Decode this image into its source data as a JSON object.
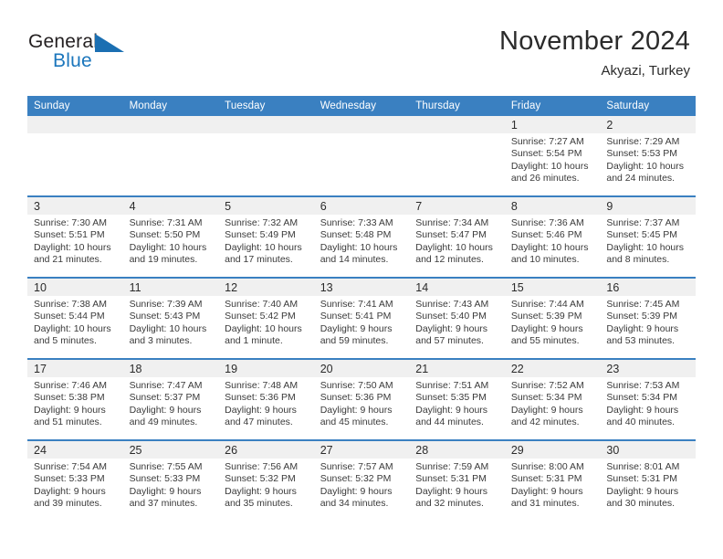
{
  "brand": {
    "name_part1": "General",
    "name_part2": "Blue",
    "mark": "triangle-logo"
  },
  "header": {
    "month_title": "November 2024",
    "location": "Akyazi, Turkey",
    "accent_color": "#3a80c1",
    "brand_blue": "#1b76bc"
  },
  "weekday_headers": [
    "Sunday",
    "Monday",
    "Tuesday",
    "Wednesday",
    "Thursday",
    "Friday",
    "Saturday"
  ],
  "weeks": [
    [
      {
        "day": "",
        "sunrise": "",
        "sunset": "",
        "daylight": "",
        "empty": true
      },
      {
        "day": "",
        "sunrise": "",
        "sunset": "",
        "daylight": "",
        "empty": true
      },
      {
        "day": "",
        "sunrise": "",
        "sunset": "",
        "daylight": "",
        "empty": true
      },
      {
        "day": "",
        "sunrise": "",
        "sunset": "",
        "daylight": "",
        "empty": true
      },
      {
        "day": "",
        "sunrise": "",
        "sunset": "",
        "daylight": "",
        "empty": true
      },
      {
        "day": "1",
        "sunrise": "Sunrise: 7:27 AM",
        "sunset": "Sunset: 5:54 PM",
        "daylight": "Daylight: 10 hours and 26 minutes.",
        "empty": false
      },
      {
        "day": "2",
        "sunrise": "Sunrise: 7:29 AM",
        "sunset": "Sunset: 5:53 PM",
        "daylight": "Daylight: 10 hours and 24 minutes.",
        "empty": false
      }
    ],
    [
      {
        "day": "3",
        "sunrise": "Sunrise: 7:30 AM",
        "sunset": "Sunset: 5:51 PM",
        "daylight": "Daylight: 10 hours and 21 minutes.",
        "empty": false
      },
      {
        "day": "4",
        "sunrise": "Sunrise: 7:31 AM",
        "sunset": "Sunset: 5:50 PM",
        "daylight": "Daylight: 10 hours and 19 minutes.",
        "empty": false
      },
      {
        "day": "5",
        "sunrise": "Sunrise: 7:32 AM",
        "sunset": "Sunset: 5:49 PM",
        "daylight": "Daylight: 10 hours and 17 minutes.",
        "empty": false
      },
      {
        "day": "6",
        "sunrise": "Sunrise: 7:33 AM",
        "sunset": "Sunset: 5:48 PM",
        "daylight": "Daylight: 10 hours and 14 minutes.",
        "empty": false
      },
      {
        "day": "7",
        "sunrise": "Sunrise: 7:34 AM",
        "sunset": "Sunset: 5:47 PM",
        "daylight": "Daylight: 10 hours and 12 minutes.",
        "empty": false
      },
      {
        "day": "8",
        "sunrise": "Sunrise: 7:36 AM",
        "sunset": "Sunset: 5:46 PM",
        "daylight": "Daylight: 10 hours and 10 minutes.",
        "empty": false
      },
      {
        "day": "9",
        "sunrise": "Sunrise: 7:37 AM",
        "sunset": "Sunset: 5:45 PM",
        "daylight": "Daylight: 10 hours and 8 minutes.",
        "empty": false
      }
    ],
    [
      {
        "day": "10",
        "sunrise": "Sunrise: 7:38 AM",
        "sunset": "Sunset: 5:44 PM",
        "daylight": "Daylight: 10 hours and 5 minutes.",
        "empty": false
      },
      {
        "day": "11",
        "sunrise": "Sunrise: 7:39 AM",
        "sunset": "Sunset: 5:43 PM",
        "daylight": "Daylight: 10 hours and 3 minutes.",
        "empty": false
      },
      {
        "day": "12",
        "sunrise": "Sunrise: 7:40 AM",
        "sunset": "Sunset: 5:42 PM",
        "daylight": "Daylight: 10 hours and 1 minute.",
        "empty": false
      },
      {
        "day": "13",
        "sunrise": "Sunrise: 7:41 AM",
        "sunset": "Sunset: 5:41 PM",
        "daylight": "Daylight: 9 hours and 59 minutes.",
        "empty": false
      },
      {
        "day": "14",
        "sunrise": "Sunrise: 7:43 AM",
        "sunset": "Sunset: 5:40 PM",
        "daylight": "Daylight: 9 hours and 57 minutes.",
        "empty": false
      },
      {
        "day": "15",
        "sunrise": "Sunrise: 7:44 AM",
        "sunset": "Sunset: 5:39 PM",
        "daylight": "Daylight: 9 hours and 55 minutes.",
        "empty": false
      },
      {
        "day": "16",
        "sunrise": "Sunrise: 7:45 AM",
        "sunset": "Sunset: 5:39 PM",
        "daylight": "Daylight: 9 hours and 53 minutes.",
        "empty": false
      }
    ],
    [
      {
        "day": "17",
        "sunrise": "Sunrise: 7:46 AM",
        "sunset": "Sunset: 5:38 PM",
        "daylight": "Daylight: 9 hours and 51 minutes.",
        "empty": false
      },
      {
        "day": "18",
        "sunrise": "Sunrise: 7:47 AM",
        "sunset": "Sunset: 5:37 PM",
        "daylight": "Daylight: 9 hours and 49 minutes.",
        "empty": false
      },
      {
        "day": "19",
        "sunrise": "Sunrise: 7:48 AM",
        "sunset": "Sunset: 5:36 PM",
        "daylight": "Daylight: 9 hours and 47 minutes.",
        "empty": false
      },
      {
        "day": "20",
        "sunrise": "Sunrise: 7:50 AM",
        "sunset": "Sunset: 5:36 PM",
        "daylight": "Daylight: 9 hours and 45 minutes.",
        "empty": false
      },
      {
        "day": "21",
        "sunrise": "Sunrise: 7:51 AM",
        "sunset": "Sunset: 5:35 PM",
        "daylight": "Daylight: 9 hours and 44 minutes.",
        "empty": false
      },
      {
        "day": "22",
        "sunrise": "Sunrise: 7:52 AM",
        "sunset": "Sunset: 5:34 PM",
        "daylight": "Daylight: 9 hours and 42 minutes.",
        "empty": false
      },
      {
        "day": "23",
        "sunrise": "Sunrise: 7:53 AM",
        "sunset": "Sunset: 5:34 PM",
        "daylight": "Daylight: 9 hours and 40 minutes.",
        "empty": false
      }
    ],
    [
      {
        "day": "24",
        "sunrise": "Sunrise: 7:54 AM",
        "sunset": "Sunset: 5:33 PM",
        "daylight": "Daylight: 9 hours and 39 minutes.",
        "empty": false
      },
      {
        "day": "25",
        "sunrise": "Sunrise: 7:55 AM",
        "sunset": "Sunset: 5:33 PM",
        "daylight": "Daylight: 9 hours and 37 minutes.",
        "empty": false
      },
      {
        "day": "26",
        "sunrise": "Sunrise: 7:56 AM",
        "sunset": "Sunset: 5:32 PM",
        "daylight": "Daylight: 9 hours and 35 minutes.",
        "empty": false
      },
      {
        "day": "27",
        "sunrise": "Sunrise: 7:57 AM",
        "sunset": "Sunset: 5:32 PM",
        "daylight": "Daylight: 9 hours and 34 minutes.",
        "empty": false
      },
      {
        "day": "28",
        "sunrise": "Sunrise: 7:59 AM",
        "sunset": "Sunset: 5:31 PM",
        "daylight": "Daylight: 9 hours and 32 minutes.",
        "empty": false
      },
      {
        "day": "29",
        "sunrise": "Sunrise: 8:00 AM",
        "sunset": "Sunset: 5:31 PM",
        "daylight": "Daylight: 9 hours and 31 minutes.",
        "empty": false
      },
      {
        "day": "30",
        "sunrise": "Sunrise: 8:01 AM",
        "sunset": "Sunset: 5:31 PM",
        "daylight": "Daylight: 9 hours and 30 minutes.",
        "empty": false
      }
    ]
  ]
}
